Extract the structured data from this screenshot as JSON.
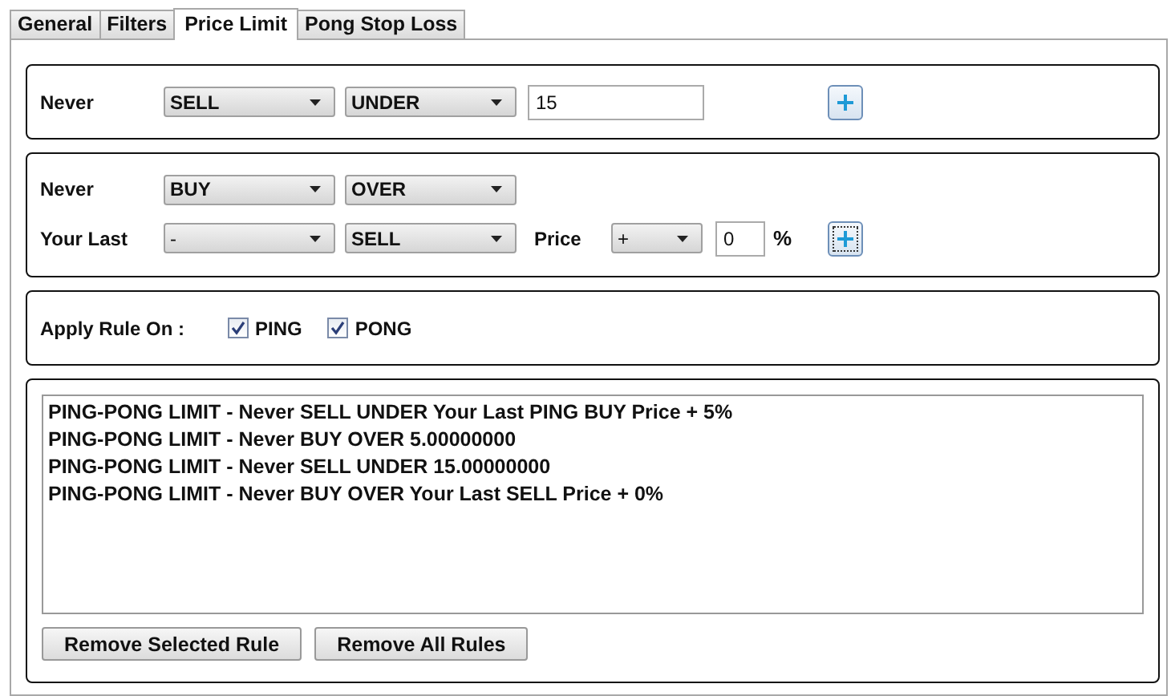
{
  "tabs": [
    {
      "label": "General",
      "selected": false
    },
    {
      "label": "Filters",
      "selected": false
    },
    {
      "label": "Price Limit",
      "selected": true
    },
    {
      "label": "Pong Stop Loss",
      "selected": false
    }
  ],
  "limit_rule": {
    "label": "Never",
    "side": "SELL",
    "condition": "UNDER",
    "value": "15",
    "add_focused": false
  },
  "relative_rule": {
    "label": "Never",
    "side": "BUY",
    "condition": "OVER",
    "last_label": "Your Last",
    "last_type": "-",
    "last_side": "SELL",
    "price_label": "Price",
    "sign": "+",
    "percent": "0",
    "percent_label": "%",
    "add_focused": true
  },
  "apply": {
    "label": "Apply Rule On :",
    "options": [
      {
        "label": "PING",
        "checked": true
      },
      {
        "label": "PONG",
        "checked": true
      }
    ]
  },
  "rules": [
    {
      "text": "PING-PONG LIMIT - Never SELL UNDER Your Last PING BUY Price + 5%",
      "selected": false
    },
    {
      "text": "PING-PONG LIMIT - Never BUY OVER 5.00000000",
      "selected": false
    },
    {
      "text": "PING-PONG LIMIT - Never SELL UNDER 15.00000000",
      "selected": false
    },
    {
      "text": "PING-PONG LIMIT - Never BUY OVER Your Last SELL Price + 0%",
      "selected": false
    }
  ],
  "buttons": [
    "Remove Selected Rule",
    "Remove All Rules"
  ]
}
